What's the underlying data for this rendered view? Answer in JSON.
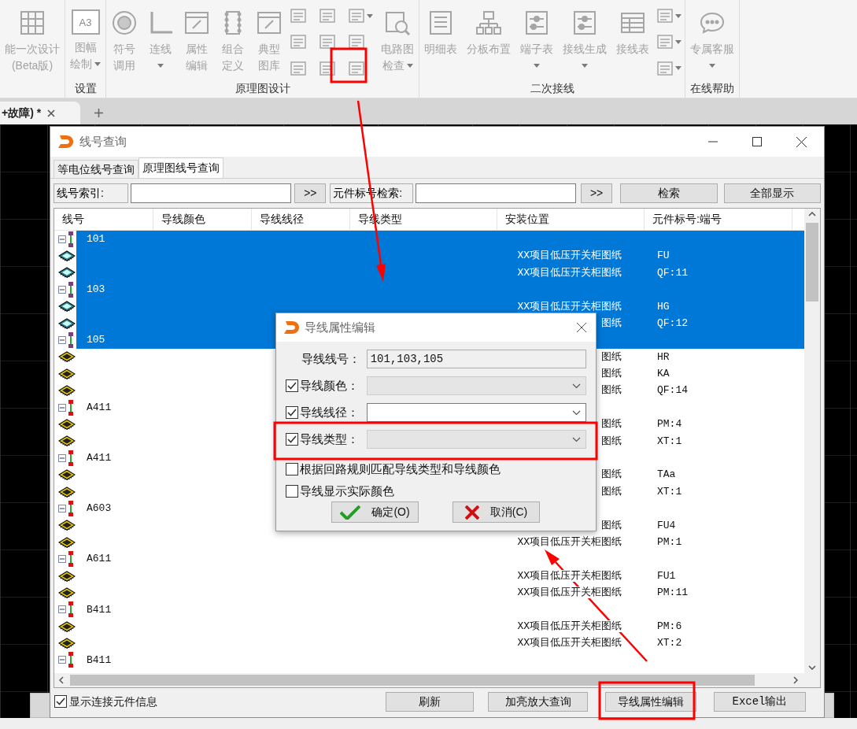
{
  "ribbon": {
    "groups": [
      {
        "items": [
          {
            "kind": "button",
            "lines": [
              "能一次设计",
              "(Beta版)"
            ],
            "dropdown": false
          }
        ]
      },
      {
        "label": "设置",
        "items": [
          {
            "kind": "button",
            "lines": [
              "图幅",
              "绘制"
            ],
            "dropdown": true,
            "badge": "A3"
          }
        ]
      },
      {
        "label": "原理图设计",
        "items": [
          {
            "kind": "button",
            "lines": [
              "符号",
              "调用"
            ],
            "dropdown": false
          },
          {
            "kind": "button",
            "lines": [
              "连线"
            ],
            "dropdown": true
          },
          {
            "kind": "button",
            "lines": [
              "属性",
              "编辑"
            ],
            "dropdown": false
          },
          {
            "kind": "button",
            "lines": [
              "组合",
              "定义"
            ],
            "dropdown": false
          },
          {
            "kind": "button",
            "lines": [
              "典型",
              "图库"
            ],
            "dropdown": false
          },
          {
            "kind": "tool_grid",
            "tools": [
              {
                "dropdown": false
              },
              {
                "dropdown": false
              },
              {
                "dropdown": true
              },
              {
                "dropdown": false
              },
              {
                "dropdown": false
              },
              {
                "dropdown": false
              },
              {
                "dropdown": false
              },
              {
                "dropdown": false
              },
              {
                "dropdown": false
              }
            ]
          },
          {
            "kind": "button",
            "lines": [
              "电路图",
              "检查"
            ],
            "dropdown": true
          }
        ]
      },
      {
        "label": "二次接线",
        "items": [
          {
            "kind": "button",
            "lines": [
              "明细表"
            ],
            "dropdown": false
          },
          {
            "kind": "button",
            "lines": [
              "分板布置"
            ],
            "dropdown": false
          },
          {
            "kind": "button",
            "lines": [
              "端子表"
            ],
            "dropdown": true
          },
          {
            "kind": "button",
            "lines": [
              "接线生成"
            ],
            "dropdown": true
          },
          {
            "kind": "button",
            "lines": [
              "接线表"
            ],
            "dropdown": false
          },
          {
            "kind": "tool_column",
            "tools": [
              {
                "dropdown": true
              },
              {
                "dropdown": true
              },
              {
                "dropdown": true
              }
            ]
          }
        ]
      },
      {
        "label": "在线帮助",
        "items": [
          {
            "kind": "button",
            "lines": [
              "专属客服"
            ],
            "dropdown": true
          }
        ]
      }
    ]
  },
  "editor_tab": {
    "label": "+故障) *"
  },
  "window": {
    "title": "线号查询"
  },
  "tabs": [
    {
      "label": "等电位线号查询",
      "selected": false
    },
    {
      "label": "原理图线号查询",
      "selected": true
    }
  ],
  "search": {
    "number_label": "线号索引:",
    "number_go": ">>",
    "component_label": "元件标号检索:",
    "component_go": ">>",
    "buttons": [
      "检索",
      "全部显示"
    ]
  },
  "table": {
    "columns": [
      "线号",
      "导线颜色",
      "导线线径",
      "导线类型",
      "安装位置",
      "元件标号:端号"
    ],
    "rows": [
      {
        "number": "101",
        "selected": true,
        "expanded": true,
        "children": [
          {
            "location": "XX项目低压开关柜图纸",
            "terminal": "FU",
            "selected": true
          },
          {
            "location": "XX项目低压开关柜图纸",
            "terminal": "QF:11",
            "selected": true
          }
        ]
      },
      {
        "number": "103",
        "selected": true,
        "expanded": true,
        "children": [
          {
            "location": "XX项目低压开关柜图纸",
            "terminal": "HG",
            "selected": true
          },
          {
            "location": "图纸",
            "terminal": "QF:12",
            "selected": true
          }
        ]
      },
      {
        "number": "105",
        "selected": true,
        "expanded": true,
        "children": [
          {
            "location": "图纸",
            "terminal": "HR",
            "selected": false
          },
          {
            "location": "图纸",
            "terminal": "KA",
            "selected": false
          },
          {
            "location": "图纸",
            "terminal": "QF:14",
            "selected": false
          }
        ]
      },
      {
        "number": "A411",
        "selected": false,
        "expanded": true,
        "children": [
          {
            "location": "图纸",
            "terminal": "PM:4",
            "selected": false
          },
          {
            "location": "图纸",
            "terminal": "XT:1",
            "selected": false
          }
        ]
      },
      {
        "number": "A411",
        "selected": false,
        "expanded": true,
        "children": [
          {
            "location": "图纸",
            "terminal": "TAa",
            "selected": false
          },
          {
            "location": "图纸",
            "terminal": "XT:1",
            "selected": false
          }
        ]
      },
      {
        "number": "A603",
        "selected": false,
        "expanded": true,
        "children": [
          {
            "location": "图纸",
            "terminal": "FU4",
            "selected": false
          },
          {
            "location": "XX项目低压开关柜图纸",
            "terminal": "PM:1",
            "selected": false
          }
        ]
      },
      {
        "number": "A611",
        "selected": false,
        "expanded": true,
        "children": [
          {
            "location": "XX项目低压开关柜图纸",
            "terminal": "FU1",
            "selected": false
          },
          {
            "location": "XX项目低压开关柜图纸",
            "terminal": "PM:11",
            "selected": false
          }
        ]
      },
      {
        "number": "B411",
        "selected": false,
        "expanded": true,
        "children": [
          {
            "location": "XX项目低压开关柜图纸",
            "terminal": "PM:6",
            "selected": false
          },
          {
            "location": "XX项目低压开关柜图纸",
            "terminal": "XT:2",
            "selected": false
          }
        ]
      },
      {
        "number": "B411",
        "selected": false,
        "expanded": true
      }
    ]
  },
  "footer": {
    "show_components": {
      "label": "显示连接元件信息",
      "checked": true
    },
    "buttons": [
      "刷新",
      "加亮放大查询",
      "导线属性编辑",
      "Excel输出"
    ]
  },
  "modal": {
    "title": "导线属性编辑",
    "fields": [
      {
        "kind": "text",
        "label": "导线线号：",
        "value": "101,103,105"
      },
      {
        "kind": "select",
        "label": "导线颜色：",
        "checked": true,
        "disabled": true
      },
      {
        "kind": "select",
        "label": "导线线径：",
        "checked": true,
        "disabled": false
      },
      {
        "kind": "select",
        "label": "导线类型：",
        "checked": true,
        "disabled": true
      }
    ],
    "options": [
      {
        "label": "根据回路规则匹配导线类型和导线颜色",
        "checked": false
      },
      {
        "label": "导线显示实际颜色",
        "checked": false
      }
    ],
    "buttons": [
      {
        "kind": "ok",
        "label": "确定(O)"
      },
      {
        "kind": "cancel",
        "label": "取消(C)"
      }
    ]
  }
}
